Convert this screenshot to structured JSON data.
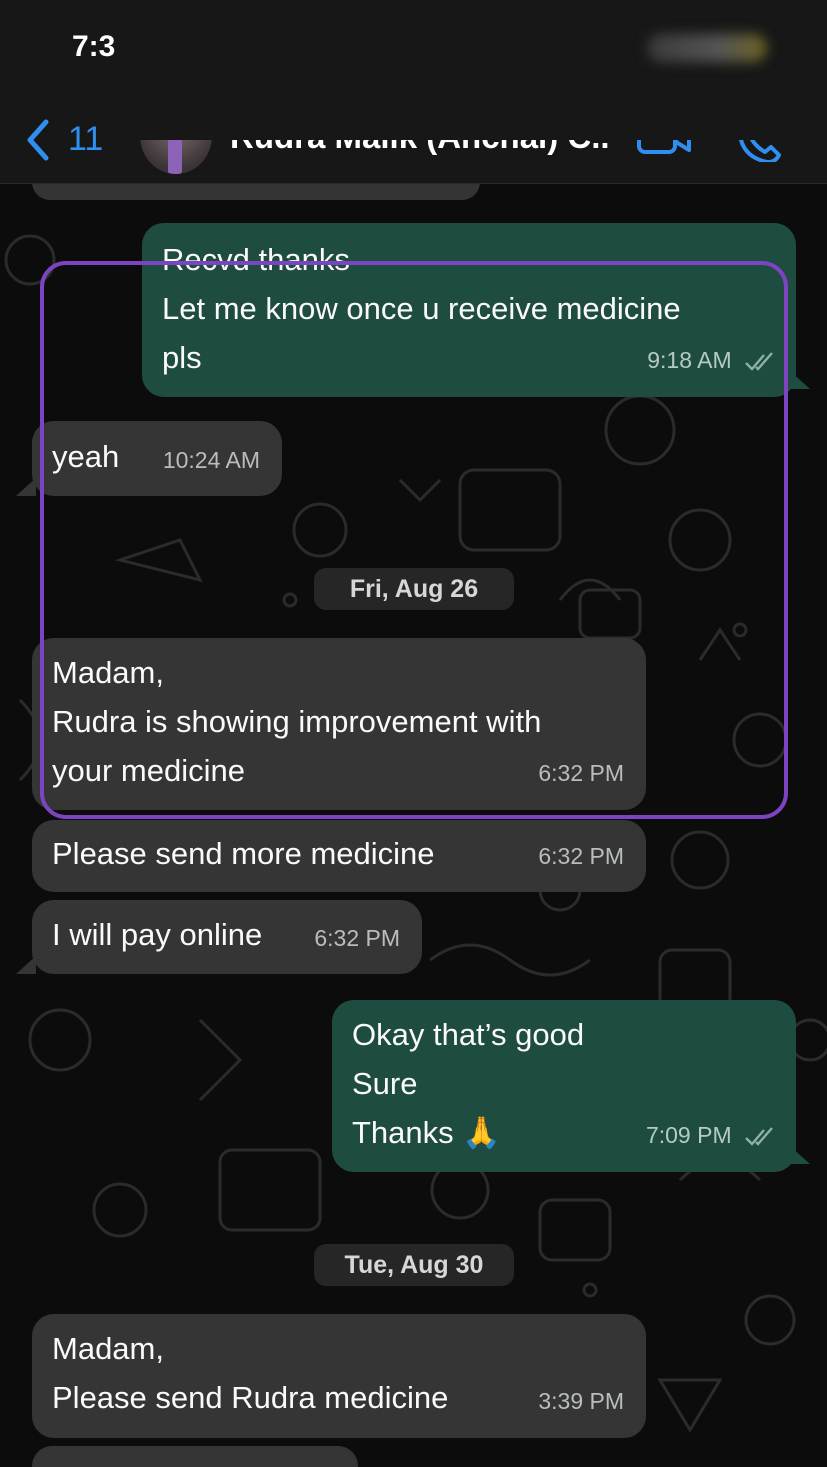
{
  "status_bar": {
    "time": "7:3"
  },
  "header": {
    "back_count": "11",
    "contact_name": "Rudra Malik (Anchal) C..."
  },
  "messages": [
    {
      "direction": "outgoing",
      "lines": [
        "Recvd thanks",
        "Let me know once u receive medicine",
        "pls"
      ],
      "time": "9:18 AM",
      "status": "read"
    },
    {
      "direction": "incoming",
      "lines": [
        "yeah"
      ],
      "time": "10:24 AM"
    },
    {
      "direction": "incoming",
      "lines": [
        "Madam,",
        "Rudra is showing improvement with",
        "your medicine"
      ],
      "time": "6:32 PM"
    },
    {
      "direction": "incoming",
      "lines": [
        "Please send more medicine"
      ],
      "time": "6:32 PM"
    },
    {
      "direction": "incoming",
      "lines": [
        "I will pay online"
      ],
      "time": "6:32 PM"
    },
    {
      "direction": "outgoing",
      "lines": [
        "Okay that’s good",
        "Sure",
        "Thanks 🙏"
      ],
      "time": "7:09 PM",
      "status": "read"
    },
    {
      "direction": "incoming",
      "lines": [
        "Madam,",
        "Please send Rudra medicine"
      ],
      "time": "3:39 PM"
    }
  ],
  "date_separators": [
    "Fri, Aug 26",
    "Tue, Aug 30"
  ],
  "colors": {
    "incoming_bubble": "#353535",
    "outgoing_bubble": "#1f4c40",
    "accent_blue": "#2f8ff0",
    "highlight_border": "#7d44c2"
  },
  "icons": [
    "chevron-left-icon",
    "video-call-icon",
    "phone-call-icon",
    "double-check-icon"
  ]
}
